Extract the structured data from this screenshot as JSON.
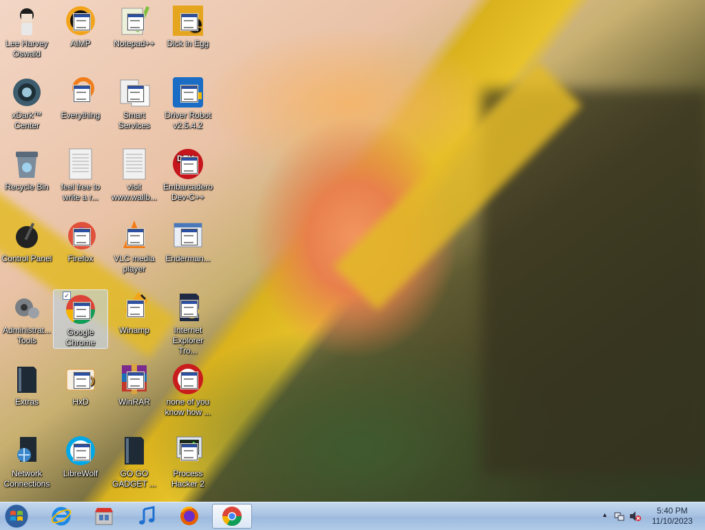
{
  "desktop": {
    "icons": [
      {
        "label": "Lee Harvey Oswald",
        "icon": "character-icon"
      },
      {
        "label": "AIMP",
        "icon": "aimp-icon"
      },
      {
        "label": "Notepad++",
        "icon": "notepad-plus-plus-icon"
      },
      {
        "label": "Dick in Egg",
        "icon": "app-icon"
      },
      {
        "label": "xDark™ Center",
        "icon": "xdark-icon"
      },
      {
        "label": "Everything",
        "icon": "everything-search-icon"
      },
      {
        "label": "Smart Services",
        "icon": "services-icon"
      },
      {
        "label": "Driver Robot v2.5.4.2",
        "icon": "driver-robot-icon"
      },
      {
        "label": "Recycle Bin",
        "icon": "recycle-bin-icon"
      },
      {
        "label": "feel free to write a r...",
        "icon": "text-document-icon"
      },
      {
        "label": "visit www.wallb...",
        "icon": "text-document-icon"
      },
      {
        "label": "Embarcadero Dev-C++",
        "icon": "devcpp-icon"
      },
      {
        "label": "Control Panel",
        "icon": "control-panel-icon"
      },
      {
        "label": "Firefox",
        "icon": "firefox-icon"
      },
      {
        "label": "VLC media player",
        "icon": "vlc-icon"
      },
      {
        "label": "Enderman...",
        "icon": "window-app-icon"
      },
      {
        "label": "Administrat... Tools",
        "icon": "admin-tools-icon"
      },
      {
        "label": "Google Chrome",
        "icon": "chrome-icon"
      },
      {
        "label": "Winamp",
        "icon": "winamp-icon"
      },
      {
        "label": "Internet Explorer Tro...",
        "icon": "ie-trojan-icon"
      },
      {
        "label": "Extras",
        "icon": "folder-icon"
      },
      {
        "label": "HxD",
        "icon": "hxd-icon"
      },
      {
        "label": "WinRAR",
        "icon": "winrar-icon"
      },
      {
        "label": "none of you know how ...",
        "icon": "app-icon"
      },
      {
        "label": "Network Connections",
        "icon": "network-icon"
      },
      {
        "label": "LibreWolf",
        "icon": "librewolf-icon"
      },
      {
        "label": "GO GO GADGET ...",
        "icon": "folder-icon"
      },
      {
        "label": "Process Hacker 2",
        "icon": "process-hacker-icon"
      }
    ]
  },
  "taskbar": {
    "start_icon": "windows-start-icon",
    "pinned": [
      {
        "name": "internet-explorer",
        "icon": "ie-icon"
      },
      {
        "name": "store",
        "icon": "store-icon"
      },
      {
        "name": "music",
        "icon": "music-note-icon"
      },
      {
        "name": "firefox",
        "icon": "firefox-icon"
      },
      {
        "name": "chrome",
        "icon": "chrome-icon",
        "active": true
      }
    ],
    "clock_time": "5:40 PM",
    "clock_date": "11/10/2023",
    "show_hidden_glyph": "▲"
  }
}
